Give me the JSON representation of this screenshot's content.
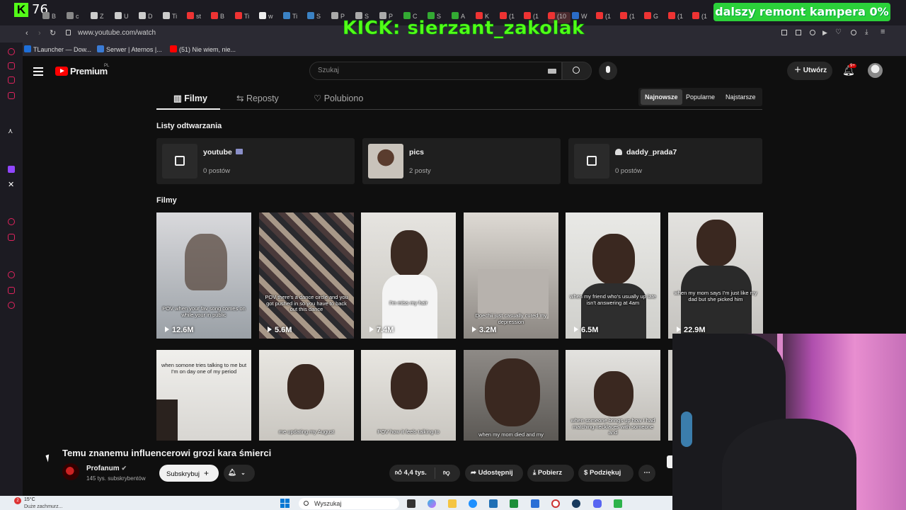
{
  "overlay": {
    "kick_logo": "K",
    "kick_count": "76",
    "kick_banner": "KICK: sierzant_zakolak",
    "donation_goal": "dalszy remont kampera 0%"
  },
  "browser": {
    "url": "www.youtube.com/watch",
    "tabs": [
      "B",
      "c",
      "Z",
      "U",
      "D",
      "Ti",
      "st",
      "B",
      "Ti",
      "w",
      "Ti",
      "S",
      "P",
      "S",
      "P",
      "C",
      "S",
      "A",
      "K",
      "(1",
      "(1",
      "(10",
      "W",
      "(1",
      "(1",
      "G",
      "(1",
      "(1"
    ],
    "bookmarks": [
      "TLauncher — Dow...",
      "Serwer | Aternos |...",
      "(51) Nie wiem, nie..."
    ]
  },
  "youtube": {
    "logo_text": "Premium",
    "logo_region": "PL",
    "search_placeholder": "Szukaj",
    "create_label": "Utwórz",
    "notif_badge": "9+",
    "channel_tabs": [
      "Filmy",
      "Reposty",
      "Polubiono"
    ],
    "sort_chips": [
      "Najnowsze",
      "Popularne",
      "Najstarsze"
    ],
    "playlists_heading": "Listy odtwarzania",
    "playlists": [
      {
        "name": "youtube",
        "count": "0 postów"
      },
      {
        "name": "pics",
        "count": "2 posty"
      },
      {
        "name": "daddy_prada7",
        "count": "0 postów"
      }
    ],
    "videos_heading": "Filmy",
    "videos_row1": [
      {
        "caption": "POV when your fav song comes on while your in public",
        "views": "12.6M"
      },
      {
        "caption": "POV there's a dance circle and you got pushed in so you have to back out this dance",
        "views": "5.6M"
      },
      {
        "caption": "I'm miss my hair",
        "views": "7.4M"
      },
      {
        "caption": "Doechii just casually cured my depression",
        "views": "3.2M"
      },
      {
        "caption": "when my friend who's usually up late isn't answering at 4am",
        "views": "6.5M"
      },
      {
        "caption": "when my mom says I'm just like my dad but she picked him",
        "views": "22.9M"
      }
    ],
    "videos_row2": [
      {
        "caption": "when somone tries talking to me but I'm on day one of my period"
      },
      {
        "caption": "me updating my August"
      },
      {
        "caption": "POV how it feels talking to"
      },
      {
        "caption": "when my mom died and my"
      },
      {
        "caption": "when someone brings up how I had matching necklaces with someone and"
      }
    ]
  },
  "player": {
    "title": "Temu znanemu influencerowi grozi kara śmierci",
    "channel": "Profanum",
    "subscribers": "145 tys. subskrybentów",
    "subscribe_label": "Subskrybuj",
    "likes": "4,4 tys.",
    "share_label": "Udostępnij",
    "download_label": "Pobierz",
    "thanks_label": "Podziękuj"
  },
  "taskbar": {
    "weather_temp": "15°C",
    "weather_desc": "Duże zachmurz...",
    "search_placeholder": "Wyszukaj",
    "notif_count": "2"
  }
}
